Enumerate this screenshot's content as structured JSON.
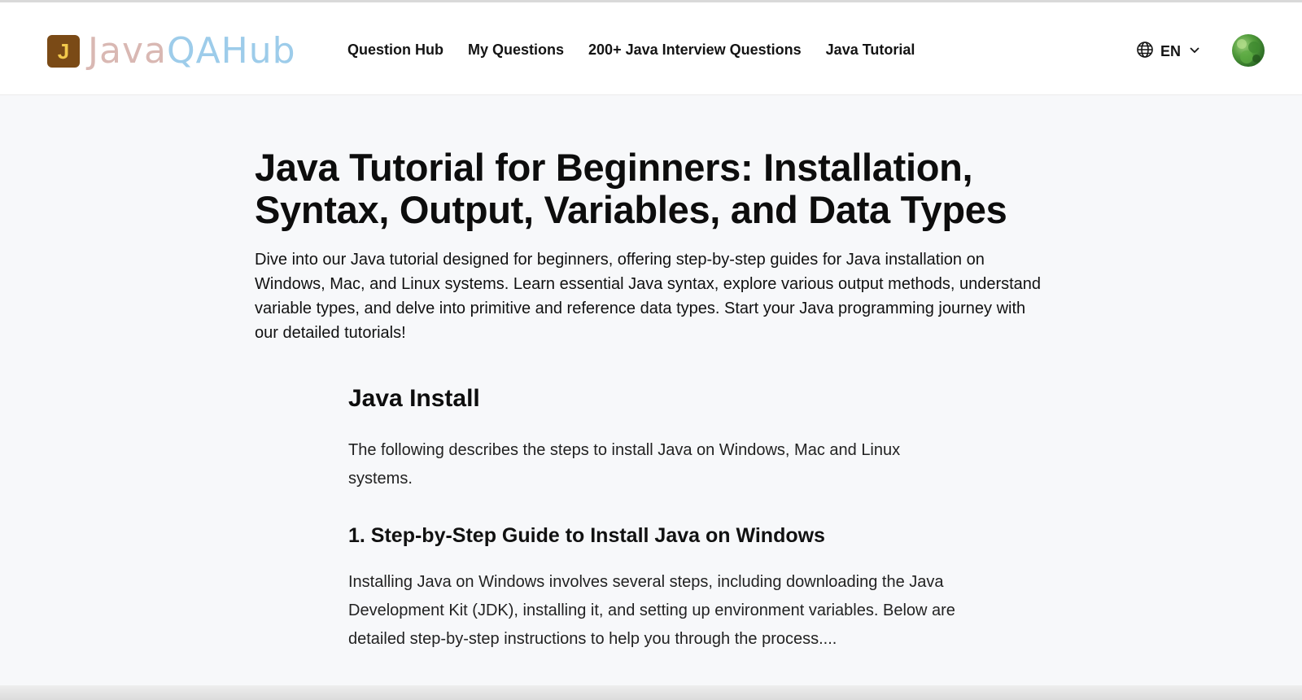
{
  "logo": {
    "badge_letter": "J",
    "text_part_1": "Java",
    "text_part_2": "QAHub",
    "badge_color": "#7a4a16",
    "badge_letter_color": "#f2c94c"
  },
  "nav": {
    "items": [
      {
        "label": "Question Hub"
      },
      {
        "label": "My Questions"
      },
      {
        "label": "200+ Java Interview Questions"
      },
      {
        "label": "Java Tutorial"
      }
    ]
  },
  "language": {
    "icon": "globe-icon",
    "selected": "EN",
    "dropdown_icon": "chevron-down-icon"
  },
  "avatar": {
    "icon": "user-avatar"
  },
  "page": {
    "title": "Java Tutorial for Beginners: Installation, Syntax, Output, Variables, and Data Types",
    "intro": "Dive into our Java tutorial designed for beginners, offering step-by-step guides for Java installation on Windows, Mac, and Linux systems. Learn essential Java syntax, explore various output methods, understand variable types, and delve into primitive and reference data types. Start your Java programming journey with our detailed tutorials!"
  },
  "article": {
    "heading": "Java Install",
    "description": "The following describes the steps to install Java on Windows, Mac and Linux systems.",
    "section_heading": "1. Step-by-Step Guide to Install Java on Windows",
    "section_text": "Installing Java on Windows involves several steps, including downloading the Java Development Kit (JDK), installing it, and setting up environment variables. Below are detailed step-by-step instructions to help you through the process...."
  }
}
